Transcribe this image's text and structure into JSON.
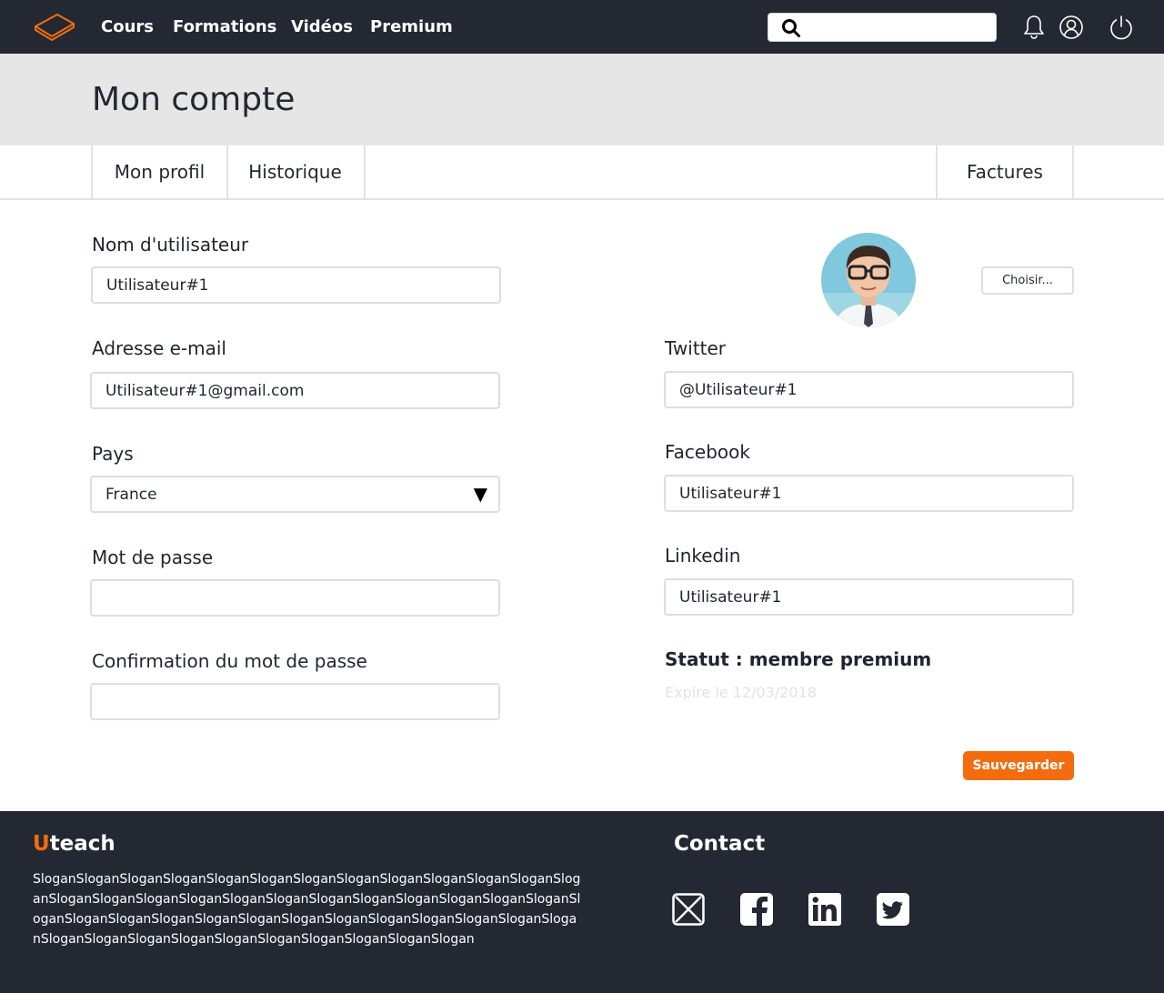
{
  "nav": {
    "links": [
      "Cours",
      "Formations",
      "Vidéos",
      "Premium"
    ],
    "search_value": ""
  },
  "header": {
    "title": "Mon compte"
  },
  "tabs": [
    "Mon profil",
    "Historique",
    "Factures"
  ],
  "form": {
    "username_label": "Nom d'utilisateur",
    "username_value": "Utilisateur#1",
    "email_label": "Adresse e-mail",
    "email_value": "Utilisateur#1@gmail.com",
    "country_label": "Pays",
    "country_value": "France",
    "password_label": "Mot de passe",
    "password_value": "",
    "confirm_label": "Confirmation du mot de passe",
    "confirm_value": "",
    "choose_button": "Choisir...",
    "twitter_label": "Twitter",
    "twitter_value": "@Utilisateur#1",
    "facebook_label": "Facebook",
    "facebook_value": "Utilisateur#1",
    "linkedin_label": "Linkedin",
    "linkedin_value": "Utilisateur#1",
    "status_label": "Statut : membre premium",
    "expire_text": "Expire le 12/03/2018",
    "save_button": "Sauvegarder"
  },
  "footer": {
    "brand_first": "U",
    "brand_rest": "teach",
    "slogan": "SloganSloganSloganSloganSloganSloganSloganSloganSloganSloganSloganSloganSloganSloganSloganSloganSloganSloganSloganSloganSloganSloganSloganSloganSloganSloganSloganSloganSloganSloganSloganSloganSloganSloganSloganSloganSloganSloganSloganSloganSloganSloganSloganSloganSloganSloganSloganSlogan",
    "contact_title": "Contact",
    "social_icons": [
      "mail-icon",
      "facebook-icon",
      "linkedin-icon",
      "twitter-icon"
    ]
  },
  "colors": {
    "nav_bg": "#232833",
    "accent": "#f36d0e",
    "header_bg": "#e6e6e6",
    "border": "#dedede"
  }
}
